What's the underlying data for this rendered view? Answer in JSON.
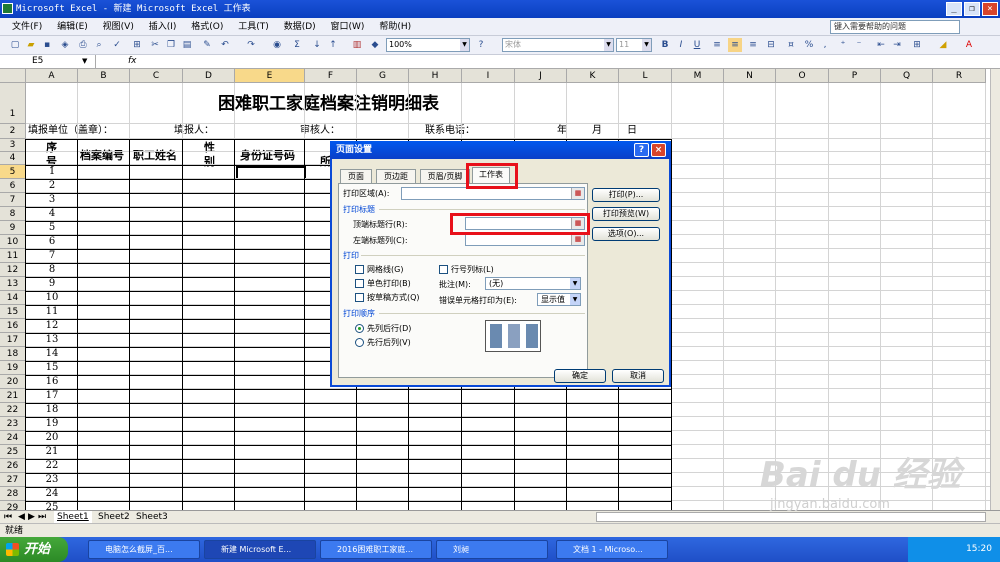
{
  "window": {
    "title": "Microsoft Excel - 新建 Microsoft Excel 工作表",
    "min": "_",
    "max": "❐",
    "close": "×"
  },
  "menubar": {
    "items": [
      "文件(F)",
      "编辑(E)",
      "视图(V)",
      "插入(I)",
      "格式(O)",
      "工具(T)",
      "数据(D)",
      "窗口(W)",
      "帮助(H)"
    ],
    "help_placeholder": "键入需要帮助的问题"
  },
  "toolbar": {
    "zoom": "100%",
    "font": "宋体",
    "size": "11"
  },
  "formula_bar": {
    "name_box": "E5",
    "fx": "fx",
    "value": ""
  },
  "columns": [
    "A",
    "B",
    "C",
    "D",
    "E",
    "F",
    "G",
    "H",
    "I",
    "J",
    "K",
    "L",
    "M",
    "N",
    "O",
    "P",
    "Q",
    "R"
  ],
  "rows": [
    "1",
    "2",
    "3",
    "4",
    "5",
    "6",
    "7",
    "8",
    "9",
    "10",
    "11",
    "12",
    "13",
    "14",
    "15",
    "16",
    "17",
    "18",
    "19",
    "20",
    "21",
    "22",
    "23",
    "24",
    "25",
    "26",
    "27",
    "28",
    "29"
  ],
  "sheet": {
    "title": "困难职工家庭档案注销明细表",
    "row2": {
      "unit": "填报单位（盖章）：",
      "filler": "填报人：",
      "reviewer": "审核人：",
      "phone": "联系电话：",
      "year": "年",
      "month": "月",
      "day": "日"
    },
    "headers": {
      "seq_top": "序",
      "seq_bottom": "号",
      "archive_no": "档案编号",
      "name": "职工姓名",
      "sex_top": "性",
      "sex_bottom": "别",
      "id_no": "身份证号码",
      "f_partial": "所"
    },
    "seq_numbers": [
      "1",
      "2",
      "3",
      "4",
      "5",
      "6",
      "7",
      "8",
      "9",
      "10",
      "11",
      "12",
      "13",
      "14",
      "15",
      "16",
      "17",
      "18",
      "19",
      "20",
      "21",
      "22",
      "23",
      "24",
      "25"
    ]
  },
  "sheet_tabs": [
    "Sheet1",
    "Sheet2",
    "Sheet3"
  ],
  "status": "就绪",
  "dialog": {
    "title": "页面设置",
    "tabs": [
      "页面",
      "页边距",
      "页眉/页脚",
      "工作表"
    ],
    "active_tab": "工作表",
    "print_area_label": "打印区域(A):",
    "print_titles_group": "打印标题",
    "top_rows_label": "顶端标题行(R):",
    "left_cols_label": "左端标题列(C):",
    "print_group": "打印",
    "gridlines": "网格线(G)",
    "black_white": "单色打印(B)",
    "draft": "按草稿方式(Q)",
    "row_col_headings": "行号列标(L)",
    "comments_label": "批注(M):",
    "comments_value": "(无)",
    "errors_label": "错误单元格打印为(E):",
    "errors_value": "显示值",
    "page_order_group": "打印顺序",
    "down_then_over": "先列后行(D)",
    "over_then_down": "先行后列(V)",
    "btn_print": "打印(P)...",
    "btn_preview": "打印预览(W)",
    "btn_options": "选项(O)...",
    "btn_ok": "确定",
    "btn_cancel": "取消",
    "help": "?",
    "close": "×"
  },
  "taskbar": {
    "start": "开始",
    "tasks": [
      "电脑怎么截屏_百...",
      "新建 Microsoft E...",
      "2016困难职工家庭...",
      "刘昶",
      "文档 1 - Microso..."
    ],
    "time": "15:20"
  },
  "watermark": {
    "logo": "Bai du 经验",
    "url": "jingyan.baidu.com"
  }
}
